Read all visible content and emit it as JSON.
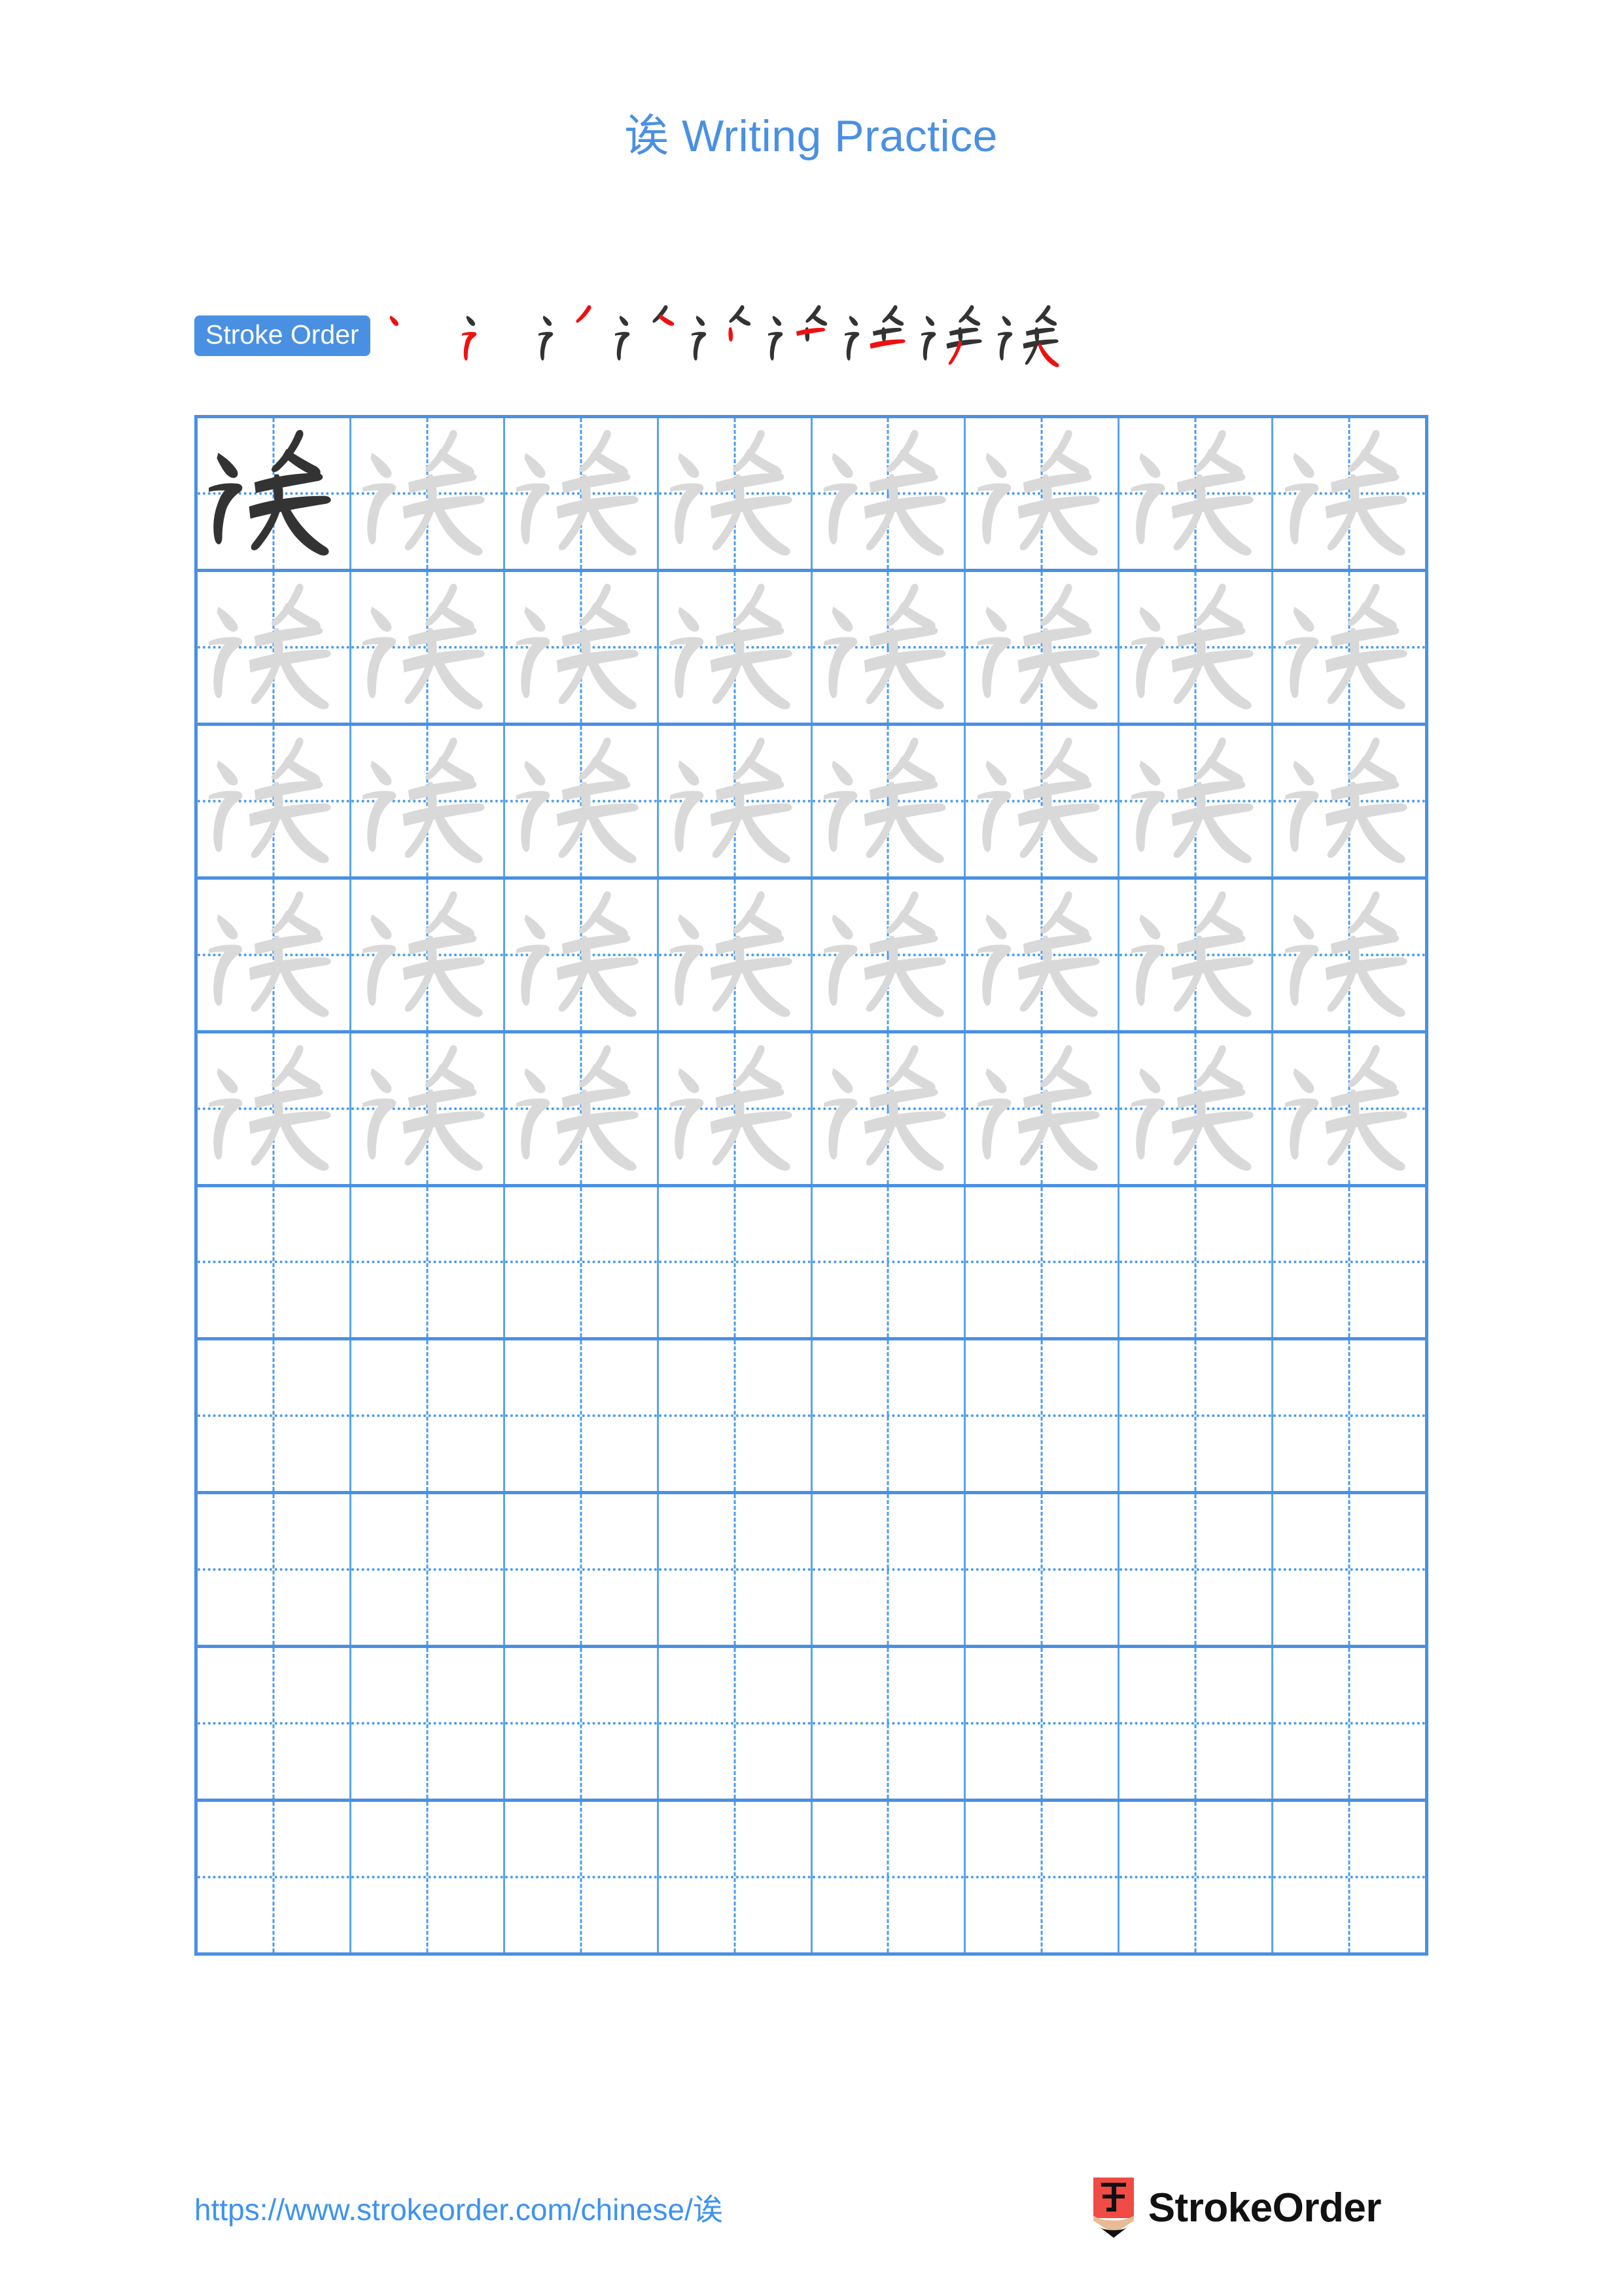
{
  "page": {
    "character": "诶",
    "title": "诶 Writing Practice",
    "title_character": "诶",
    "title_text": " Writing Practice",
    "accent_color": "#4a90e2",
    "grid_line_color": "#57a4f0",
    "guide_line_color": "#4a9cf0",
    "model_char_color": "#333333",
    "trace_char_color": "#d9d9d9",
    "stroke_new_color": "#ee1111",
    "stroke_old_color": "#333333"
  },
  "stroke_order": {
    "badge_label": "Stroke Order",
    "stroke_count": 9,
    "steps": [
      {
        "index": 1,
        "label": "stroke-1",
        "new_stroke": "dot"
      },
      {
        "index": 2,
        "label": "stroke-2",
        "new_stroke": "horizontal-fold-tick"
      },
      {
        "index": 3,
        "label": "stroke-3",
        "new_stroke": "left-falling"
      },
      {
        "index": 4,
        "label": "stroke-4",
        "new_stroke": "fold"
      },
      {
        "index": 5,
        "label": "stroke-5",
        "new_stroke": "dot"
      },
      {
        "index": 6,
        "label": "stroke-6",
        "new_stroke": "horizontal"
      },
      {
        "index": 7,
        "label": "stroke-7",
        "new_stroke": "horizontal"
      },
      {
        "index": 8,
        "label": "stroke-8",
        "new_stroke": "left-falling"
      },
      {
        "index": 9,
        "label": "stroke-9",
        "new_stroke": "right-falling"
      }
    ]
  },
  "practice_grid": {
    "columns": 8,
    "rows": 10,
    "filled_rows": 5,
    "empty_rows": 5,
    "model_cell": {
      "row": 1,
      "column": 1
    },
    "cell_character": "诶"
  },
  "footer": {
    "url": "https://www.strokeorder.com/chinese/诶",
    "brand_name": "StrokeOrder",
    "brand_logo_char": "字"
  }
}
